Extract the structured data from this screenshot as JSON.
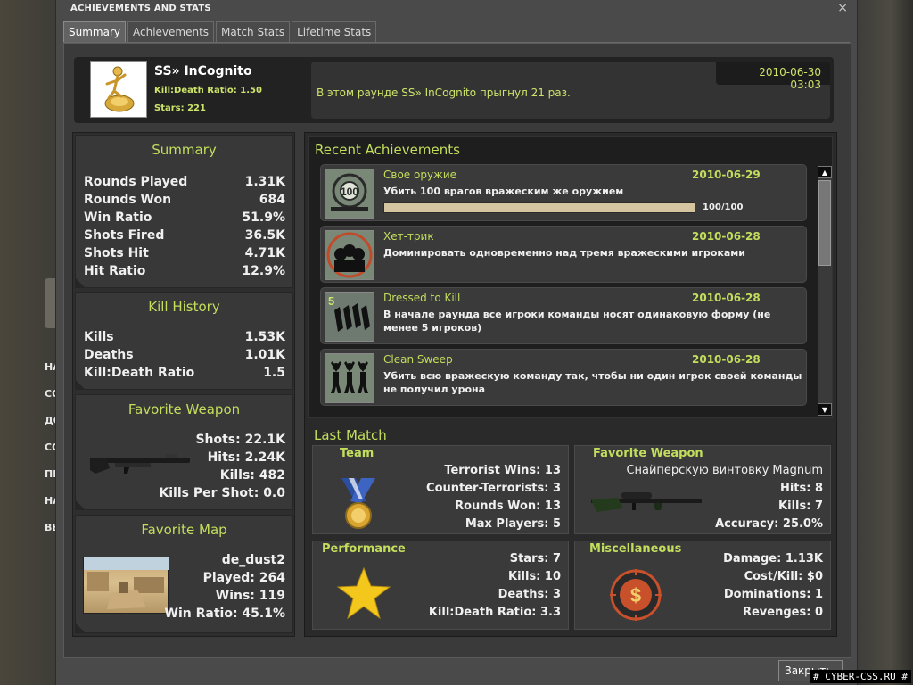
{
  "window": {
    "title": "ACHIEVEMENTS AND STATS",
    "close_icon": "×"
  },
  "tabs": [
    {
      "label": "Summary",
      "active": true
    },
    {
      "label": "Achievements"
    },
    {
      "label": "Match Stats"
    },
    {
      "label": "Lifetime Stats"
    }
  ],
  "profile": {
    "name": "SS» InCognito",
    "kd_ratio": "Kill:Death Ratio: 1.50",
    "stars": "Stars: 221",
    "date": "2010-06-30 03:03",
    "message": "В этом раунде SS» InCognito прыгнул 21 раз."
  },
  "summary": {
    "title": "Summary",
    "rows": [
      {
        "label": "Rounds Played",
        "value": "1.31K"
      },
      {
        "label": "Rounds Won",
        "value": "684"
      },
      {
        "label": "Win Ratio",
        "value": "51.9%"
      },
      {
        "label": "Shots Fired",
        "value": "36.5K"
      },
      {
        "label": "Shots Hit",
        "value": "4.71K"
      },
      {
        "label": "Hit Ratio",
        "value": "12.9%"
      }
    ]
  },
  "kill_history": {
    "title": "Kill History",
    "rows": [
      {
        "label": "Kills",
        "value": "1.53K"
      },
      {
        "label": "Deaths",
        "value": "1.01K"
      },
      {
        "label": "Kill:Death Ratio",
        "value": "1.5"
      }
    ]
  },
  "favorite_weapon": {
    "title": "Favorite Weapon",
    "rows": [
      "Shots: 22.1K",
      "Hits: 2.24K",
      "Kills: 482",
      "Kills Per Shot: 0.0"
    ]
  },
  "favorite_map": {
    "title": "Favorite Map",
    "rows": [
      "de_dust2",
      "Played: 264",
      "Wins: 119",
      "Win Ratio: 45.1%"
    ]
  },
  "recent_achievements": {
    "title": "Recent Achievements",
    "items": [
      {
        "name": "Свое оружие",
        "date": "2010-06-29",
        "desc": "Убить 100 врагов вражеским же оружием",
        "progress": 1.0,
        "progress_text": "100/100",
        "icon": "crosshair-100-icon"
      },
      {
        "name": "Хет-трик",
        "date": "2010-06-28",
        "desc": "Доминировать одновременно над тремя вражескими игроками",
        "icon": "hat-trick-icon"
      },
      {
        "name": "Dressed to Kill",
        "date": "2010-06-28",
        "desc": "В начале раунда все игроки команды носят одинаковую форму (не менее 5 игроков)",
        "icon": "dressed-to-kill-icon"
      },
      {
        "name": "Clean Sweep",
        "date": "2010-06-28",
        "desc": "Убить всю вражескую команду так, чтобы ни один игрок своей команды не получил урона",
        "icon": "clean-sweep-icon"
      }
    ]
  },
  "last_match": {
    "title": "Last Match",
    "team": {
      "title": "Team",
      "rows": [
        "Terrorist Wins: 13",
        "Counter-Terrorists: 3",
        "Rounds Won: 13",
        "Max Players: 5"
      ]
    },
    "weapon": {
      "title": "Favorite Weapon",
      "name": "Снайперскую винтовку Magnum",
      "rows": [
        "Hits: 8",
        "Kills: 7",
        "Accuracy: 25.0%"
      ]
    },
    "performance": {
      "title": "Performance",
      "rows": [
        "Stars: 7",
        "Kills: 10",
        "Deaths: 3",
        "Kill:Death Ratio: 3.3"
      ]
    },
    "misc": {
      "title": "Miscellaneous",
      "rows": [
        "Damage: 1.13K",
        "Cost/Kill: $0",
        "Dominations: 1",
        "Revenges: 0"
      ]
    }
  },
  "footer": {
    "close_label": "Закрыть"
  },
  "background_menu": [
    "НА",
    "СО",
    "ДО",
    "СО",
    "ПР",
    "НА",
    "ВЫ"
  ],
  "watermark": "# CYBER-CSS.RU #",
  "colors": {
    "accent_green": "#c2de5c",
    "panel": "#383838",
    "window": "#4a4a4a"
  }
}
